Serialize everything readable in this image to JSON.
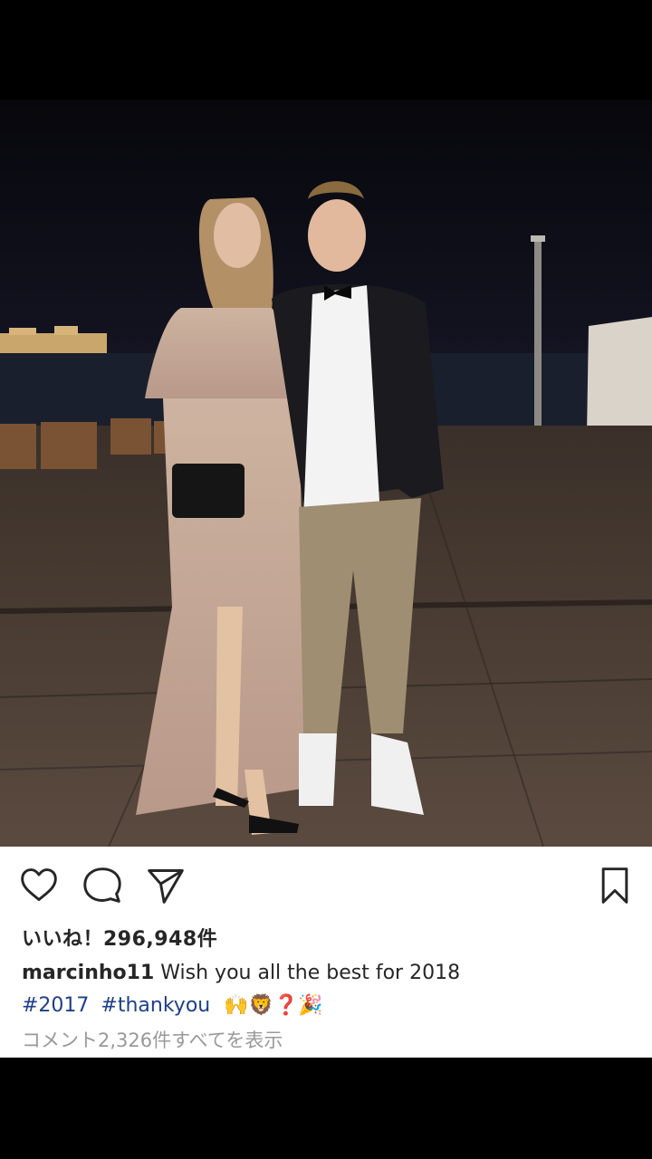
{
  "post": {
    "likes_text": "いいね！296,948件",
    "username": "marcinho11",
    "caption": "Wish you all the best for 2018",
    "hashtags": [
      "#2017",
      "#thankyou"
    ],
    "emojis": "🙌🦁❓🎉",
    "view_comments": "コメント2,326件すべてを表示"
  },
  "icons": {
    "like": "heart-icon",
    "comment": "comment-icon",
    "share": "paper-plane-icon",
    "save": "bookmark-icon"
  }
}
